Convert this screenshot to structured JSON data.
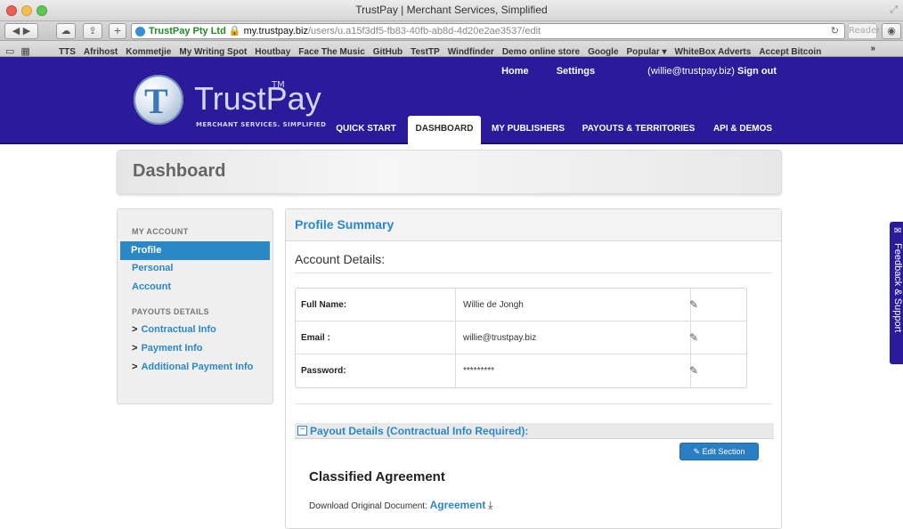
{
  "browser": {
    "window_title": "TrustPay | Merchant Services, Simplified",
    "address": {
      "ev_cert": "TrustPay Pty Ltd",
      "host": "my.trustpay.biz",
      "path": "/users/u.a15f3df5-fb83-40fb-ab8d-4d20e2ae3537/edit"
    },
    "reader_label": "Reader",
    "bookmarks": [
      "TTS",
      "Afrihost",
      "Kommetjie",
      "My Writing Spot",
      "Houtbay",
      "Face The Music",
      "GitHub",
      "TestTP",
      "Windfinder",
      "Demo online store",
      "Google",
      "Popular ▾",
      "WhiteBox Adverts",
      "Accept Bitcoin"
    ],
    "bookmarks_overflow": "»"
  },
  "header": {
    "logo_word": "TrustPay",
    "logo_tm": "TM",
    "tagline": "MERCHANT SERVICES. SIMPLIFIED",
    "top_links": {
      "home": "Home",
      "settings": "Settings",
      "email": "(willie@trustpay.biz)",
      "signout": "Sign out"
    },
    "nav": [
      "QUICK START",
      "DASHBOARD",
      "MY PUBLISHERS",
      "PAYOUTS & TERRITORIES",
      "API & DEMOS"
    ],
    "active_nav": "DASHBOARD"
  },
  "page_title": "Dashboard",
  "sidebar": {
    "my_account": "MY ACCOUNT",
    "items": [
      "Profile",
      "Personal",
      "Account"
    ],
    "active_item": "Profile",
    "payouts_details": "PAYOUTS DETAILS",
    "sub_items": [
      "Contractual Info",
      "Payment Info",
      "Additional Payment Info"
    ]
  },
  "main": {
    "title": "Profile Summary",
    "account_details": "Account Details:",
    "rows": [
      {
        "label": "Full Name:",
        "value": "Willie de Jongh"
      },
      {
        "label": "Email :",
        "value": "willie@trustpay.biz"
      },
      {
        "label": "Password:",
        "value": "*********"
      }
    ],
    "payout_title": "Payout Details (Contractual Info Required):",
    "edit_section": "Edit Section",
    "classified": "Classified Agreement",
    "download_label": "Download Original Document:",
    "download_link": "Agreement"
  },
  "feedback": "Feedback & Support",
  "colors": {
    "brand": "#2b1a9a",
    "link": "#2a88c7",
    "button": "#2a7ec3"
  }
}
